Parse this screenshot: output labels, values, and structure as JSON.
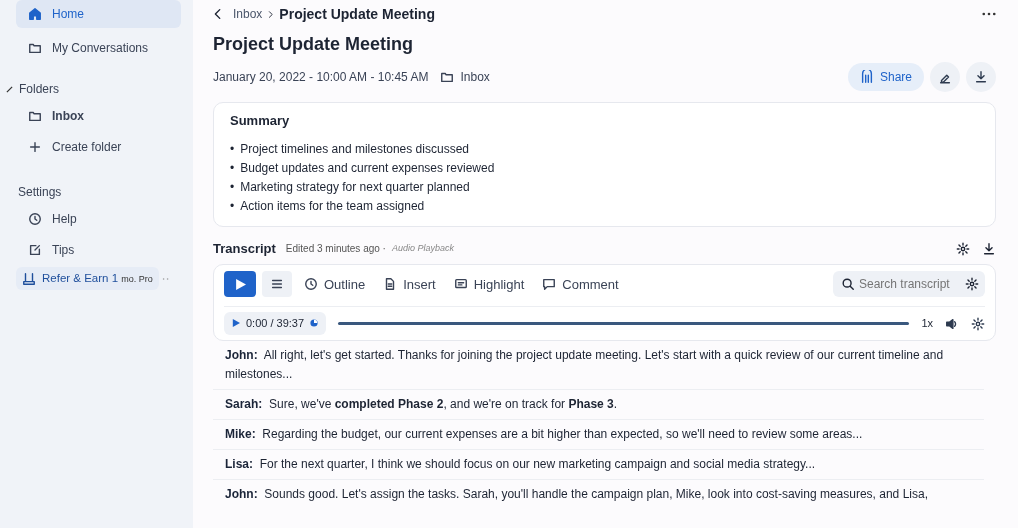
{
  "sidebar": {
    "items": [
      {
        "label": "Home",
        "selected": true
      },
      {
        "label": "My Conversations",
        "selected": false
      }
    ],
    "folders_heading": "Folders",
    "folders": [
      {
        "label": "Inbox",
        "selected": false
      },
      {
        "label": "Create folder",
        "selected": false
      }
    ],
    "settings_heading": "Settings",
    "settings": [
      {
        "label": "Help",
        "selected": false
      },
      {
        "label": "Tips",
        "selected": false
      }
    ],
    "refer": {
      "label": "Refer & Earn 1",
      "badge": "mo. Pro"
    }
  },
  "breadcrumb": {
    "parent": "Inbox",
    "current": "Project Update Meeting"
  },
  "title": "Project Update Meeting",
  "meta": {
    "datetime": "January 20, 2022 - 10:00 AM - 10:45 AM",
    "folder": "Inbox"
  },
  "share_button": "Share",
  "summary": {
    "heading": "Summary",
    "marker": "•",
    "bullets": [
      "Project timelines and milestones discussed",
      "Budget updates and current expenses reviewed",
      "Marketing strategy for next quarter planned",
      "Action items for the team assigned"
    ]
  },
  "transcript": {
    "heading": "Transcript",
    "edited": "Edited 3 minutes ago ·",
    "playback": "Audio Playback",
    "toolbar": [
      {
        "label": "Outline"
      },
      {
        "label": "Insert"
      },
      {
        "label": "Highlight"
      },
      {
        "label": "Comment"
      }
    ],
    "search": {
      "placeholder": "Search transcript"
    },
    "player": {
      "time": "0:00 / 39:37",
      "speed": "1x"
    },
    "lines": [
      {
        "speaker": "John:",
        "text": "All right, let's get started. Thanks for joining the project update meeting. Let's start with a quick review of our current timeline and milestones..."
      },
      {
        "speaker": "Sarah:",
        "text": "Sure, we've **completed Phase 2**, and we're on track for **Phase 3**."
      },
      {
        "speaker": "Mike:",
        "text": "Regarding the budget, our current expenses are a bit higher than expected, so we'll need to review some areas..."
      },
      {
        "speaker": "Lisa:",
        "text": "For the next quarter, I think we should focus on our new marketing campaign and social media strategy..."
      },
      {
        "speaker": "John:",
        "text": "Sounds good. Let's assign the tasks. Sarah, you'll handle the campaign plan, Mike, look into cost-saving measures, and Lisa,"
      }
    ]
  }
}
